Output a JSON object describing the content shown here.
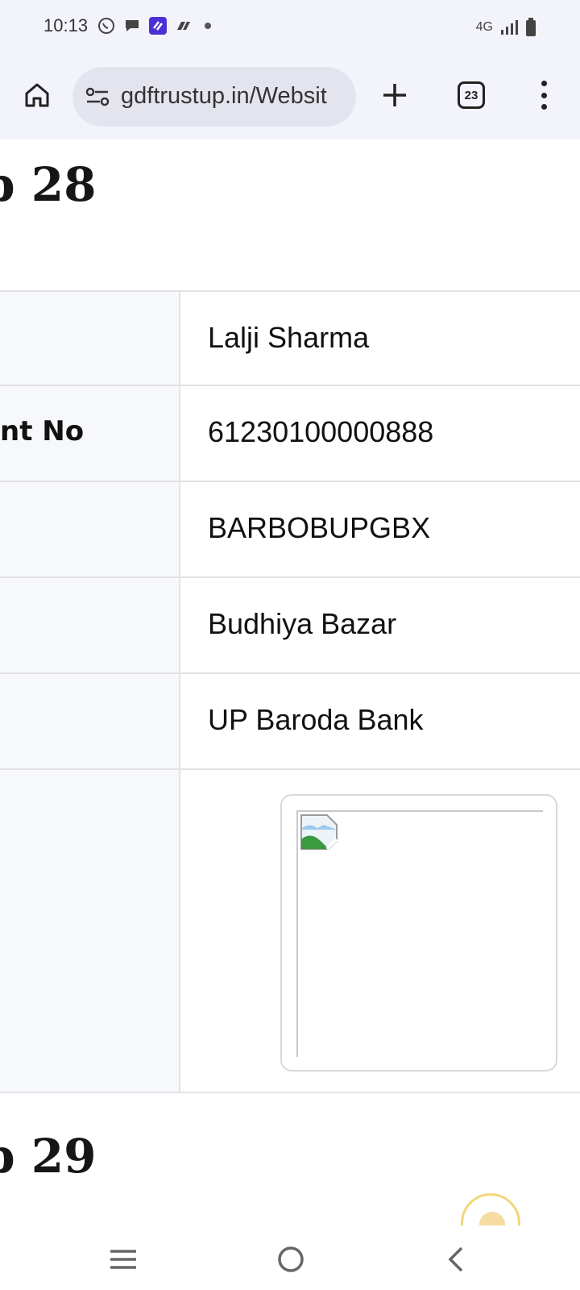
{
  "status_bar": {
    "time": "10:13",
    "network": "4G",
    "notification_icons": [
      "whatsapp-icon",
      "chat-icon",
      "app-icon",
      "drive-icon"
    ]
  },
  "browser": {
    "url": "gdftrustup.in/Websit",
    "tab_count": "23"
  },
  "page": {
    "section_28_title": "p 28",
    "section_29_title": "p 29",
    "rows": [
      {
        "label": "",
        "value": "Lalji Sharma"
      },
      {
        "label": "nt No",
        "value": "61230100000888"
      },
      {
        "label": "",
        "value": "BARBOBUPGBX"
      },
      {
        "label": "",
        "value": "Budhiya Bazar"
      },
      {
        "label": "",
        "value": "UP Baroda Bank"
      }
    ]
  },
  "colors": {
    "accent_app_icon": "#4b2fd6",
    "label_bg": "#f7f8fb",
    "border": "#e2e2e6"
  }
}
